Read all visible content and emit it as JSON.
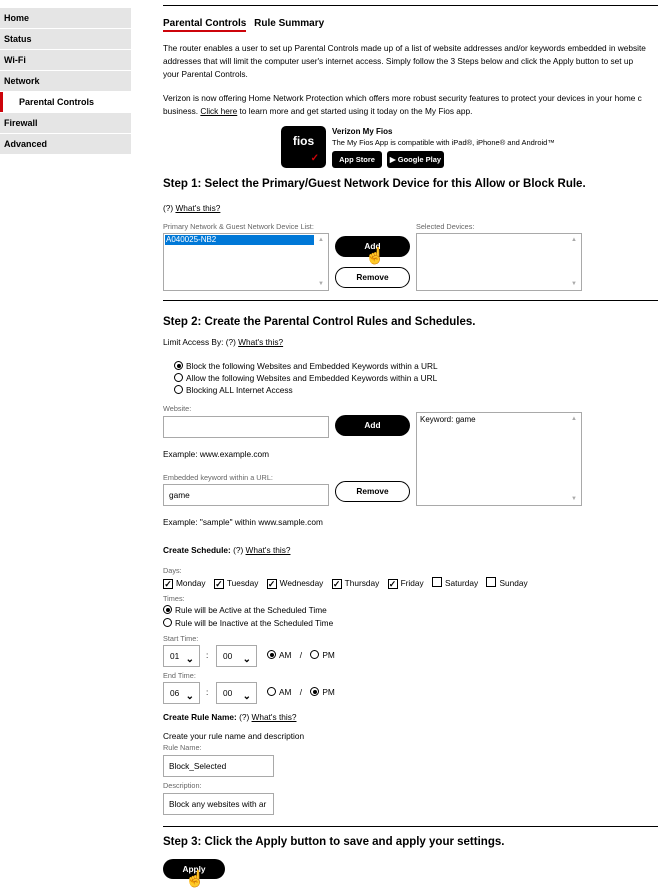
{
  "sidebar": {
    "items": [
      {
        "label": "Home"
      },
      {
        "label": "Status"
      },
      {
        "label": "Wi-Fi"
      },
      {
        "label": "Network"
      },
      {
        "label": "Parental Controls"
      },
      {
        "label": "Firewall"
      },
      {
        "label": "Advanced"
      }
    ]
  },
  "tabs": {
    "parental": "Parental Controls",
    "summary": "Rule Summary"
  },
  "intro": {
    "line1": "The router enables a user to set up Parental Controls made up of a list of website addresses and/or keywords embedded in website",
    "line2": "addresses that will limit the computer user's internet access. Simply follow the 3 Steps below and click the Apply button to set up",
    "line3": "your Parental Controls.",
    "hnp1": "Verizon is now offering Home Network Protection which offers more robust security features to protect your devices in your home c",
    "hnp2_link": "Click here",
    "hnp2_text": " to learn more and get started using it today on the My Fios app.",
    "hnp2_pre": "business. "
  },
  "app": {
    "logo": "fios",
    "title": "Verizon My Fios",
    "subtitle": "The My Fios App is compatible with iPad®, iPhone® and Android™",
    "appstore": "App Store",
    "googleplay": "Google Play"
  },
  "step1": {
    "heading": "Step 1: Select the Primary/Guest Network Device for this Allow or Block Rule.",
    "help": "(?) ",
    "help_link": "What's this?",
    "device_list_label": "Primary Network & Guest Network Device List:",
    "devices": [
      "A040025-NB2"
    ],
    "selected_label": "Selected Devices:",
    "add": "Add",
    "remove": "Remove"
  },
  "step2": {
    "heading": "Step 2: Create the Parental Control Rules and Schedules.",
    "limit_label": "Limit Access By: (?) ",
    "help_link": "What's this?",
    "options": [
      {
        "label": "Block the following Websites and Embedded Keywords within a URL",
        "selected": true
      },
      {
        "label": "Allow the following Websites and Embedded Keywords within a URL",
        "selected": false
      },
      {
        "label": "Blocking ALL Internet Access",
        "selected": false
      }
    ],
    "website_label": "Website:",
    "website_value": "",
    "add": "Add",
    "website_example": "Example: www.example.com",
    "keyword_label": "Embedded keyword within a URL:",
    "keyword_value": "game",
    "remove": "Remove",
    "keyword_example": "Example: \"sample\" within www.sample.com",
    "rules_list": [
      "Keyword: game"
    ]
  },
  "schedule": {
    "label": "Create Schedule:",
    "help_pre": " (?) ",
    "help_link": "What's this?",
    "days_label": "Days:",
    "days": [
      {
        "label": "Monday",
        "checked": true
      },
      {
        "label": "Tuesday",
        "checked": true
      },
      {
        "label": "Wednesday",
        "checked": true
      },
      {
        "label": "Thursday",
        "checked": true
      },
      {
        "label": "Friday",
        "checked": true
      },
      {
        "label": "Saturday",
        "checked": false
      },
      {
        "label": "Sunday",
        "checked": false
      }
    ],
    "times_label": "Times:",
    "active_opt": "Rule will be Active at the Scheduled Time",
    "inactive_opt": "Rule will be Inactive at the Scheduled Time",
    "active_selected": true,
    "start_label": "Start Time:",
    "start_hour": "01",
    "start_min": "00",
    "start_ampm": "AM",
    "end_label": "End Time:",
    "end_hour": "06",
    "end_min": "00",
    "end_ampm": "PM",
    "am": "AM",
    "pm": "PM",
    "colon": ":",
    "slash": "/"
  },
  "rule_name": {
    "label": "Create Rule Name:",
    "help_pre": " (?) ",
    "help_link": "What's this?",
    "desc": "Create your rule name and description",
    "name_label": "Rule Name:",
    "name_value": "Block_Selected",
    "description_label": "Description:",
    "description_value": "Block any websites with ar"
  },
  "step3": {
    "heading": "Step 3: Click the Apply button to save and apply your settings.",
    "apply": "Apply"
  },
  "colors": {
    "accent": "#cd040b",
    "sidebar_bg": "#e5e5e5",
    "selection": "#0078d7"
  }
}
